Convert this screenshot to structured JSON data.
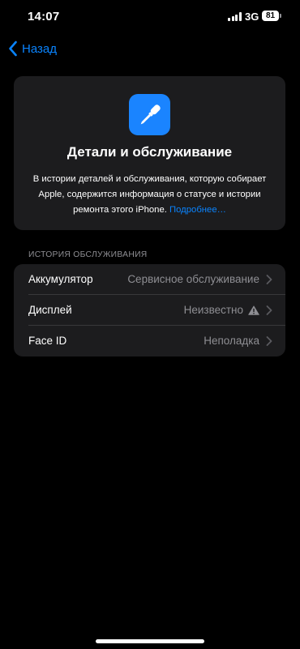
{
  "status_bar": {
    "time": "14:07",
    "network": "3G",
    "battery": "81"
  },
  "nav": {
    "back_label": "Назад"
  },
  "card": {
    "icon": "screwdriver-icon",
    "title": "Детали и обслуживание",
    "description": "В истории деталей и обслуживания, которую собирает Apple, содержится информация о статусе и истории ремонта этого iPhone.",
    "link_label": "Подробнее…"
  },
  "service_history": {
    "header": "ИСТОРИЯ ОБСЛУЖИВАНИЯ",
    "rows": [
      {
        "title": "Аккумулятор",
        "value": "Сервисное обслуживание"
      },
      {
        "title": "Дисплей",
        "value": "Неизвестно",
        "icon": "warning-icon"
      },
      {
        "title": "Face ID",
        "value": "Неполадка"
      }
    ]
  },
  "colors": {
    "accent": "#0a84ff",
    "background": "#000000",
    "card": "#1c1c1e",
    "secondary_text": "#8e8e93"
  }
}
